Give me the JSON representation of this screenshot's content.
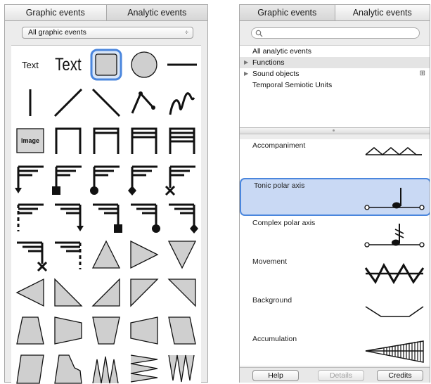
{
  "left_panel": {
    "tabs": [
      {
        "label": "Graphic events",
        "active": true
      },
      {
        "label": "Analytic events",
        "active": false
      }
    ],
    "filter": {
      "value": "All graphic events",
      "arrows": "÷"
    },
    "grid_cells": [
      {
        "name": "text-small-tool",
        "kind": "text-small",
        "text": "Text"
      },
      {
        "name": "text-large-tool",
        "kind": "text-large",
        "text": "Text"
      },
      {
        "name": "rounded-rect-tool",
        "kind": "rounded-rect",
        "selected": true
      },
      {
        "name": "circle-tool",
        "kind": "circle"
      },
      {
        "name": "horizontal-line-tool",
        "kind": "hline"
      },
      {
        "name": "vertical-line-tool",
        "kind": "vline"
      },
      {
        "name": "diagonal-up-line-tool",
        "kind": "diag-up"
      },
      {
        "name": "diagonal-down-line-tool",
        "kind": "diag-down"
      },
      {
        "name": "polyline-tool",
        "kind": "polyline"
      },
      {
        "name": "freehand-curve-tool",
        "kind": "freehand"
      },
      {
        "name": "image-tool",
        "kind": "image",
        "text": "Image"
      },
      {
        "name": "bracket-1-tool",
        "kind": "bracket1"
      },
      {
        "name": "bracket-2-tool",
        "kind": "bracket2"
      },
      {
        "name": "bracket-3-tool",
        "kind": "bracket3"
      },
      {
        "name": "bracket-4-tool",
        "kind": "bracket4"
      },
      {
        "name": "flag-arrow-tool",
        "kind": "flag-arrow"
      },
      {
        "name": "flag-square-tool",
        "kind": "flag-square"
      },
      {
        "name": "flag-circle-tool",
        "kind": "flag-circle"
      },
      {
        "name": "flag-diamond-tool",
        "kind": "flag-diamond"
      },
      {
        "name": "flag-cross-tool",
        "kind": "flag-cross"
      },
      {
        "name": "dashed-flag-tool",
        "kind": "dflag"
      },
      {
        "name": "rev-flag-arrow-tool",
        "kind": "rflag-arrow"
      },
      {
        "name": "rev-flag-square-tool",
        "kind": "rflag-square"
      },
      {
        "name": "rev-flag-circle-tool",
        "kind": "rflag-circle"
      },
      {
        "name": "rev-flag-diamond-tool",
        "kind": "rflag-diamond"
      },
      {
        "name": "rev-flag-cross-tool",
        "kind": "rflag-cross"
      },
      {
        "name": "rev-dashed-flag-tool",
        "kind": "rdflag"
      },
      {
        "name": "triangle-up-tool",
        "kind": "tri-up"
      },
      {
        "name": "triangle-right-tool",
        "kind": "tri-right"
      },
      {
        "name": "triangle-down-tool",
        "kind": "tri-down"
      },
      {
        "name": "triangle-left-tool",
        "kind": "tri-left"
      },
      {
        "name": "right-triangle-br-tool",
        "kind": "rt-br"
      },
      {
        "name": "right-triangle-bl-tool",
        "kind": "rt-bl"
      },
      {
        "name": "right-triangle-tl-tool",
        "kind": "rt-tl"
      },
      {
        "name": "right-triangle-tr-tool",
        "kind": "rt-tr"
      },
      {
        "name": "trapezoid-up-tool",
        "kind": "trap-up"
      },
      {
        "name": "trapezoid-right-tool",
        "kind": "trap-right"
      },
      {
        "name": "trapezoid-down-tool",
        "kind": "trap-down"
      },
      {
        "name": "trapezoid-left-tool",
        "kind": "trap-left"
      },
      {
        "name": "trapezoid-skew-tool",
        "kind": "trap-skew"
      },
      {
        "name": "parallelogram-tool",
        "kind": "para"
      },
      {
        "name": "notched-shape-tool",
        "kind": "notch"
      },
      {
        "name": "zigzag-up-tool",
        "kind": "zz-up"
      },
      {
        "name": "zigzag-right-tool",
        "kind": "zz-right"
      },
      {
        "name": "zigzag-down-tool",
        "kind": "zz-down"
      }
    ]
  },
  "right_panel": {
    "tabs": [
      {
        "label": "Graphic events",
        "active": false
      },
      {
        "label": "Analytic events",
        "active": true
      }
    ],
    "search": {
      "placeholder": ""
    },
    "tree": [
      {
        "label": "All analytic events",
        "expandable": false
      },
      {
        "label": "Functions",
        "expandable": true,
        "selected": true
      },
      {
        "label": "Sound objects",
        "expandable": true,
        "badge": "⊞"
      },
      {
        "label": "Temporal Semiotic Units",
        "expandable": false
      }
    ],
    "items": [
      {
        "label": "Accompaniment",
        "kind": "accompaniment"
      },
      {
        "label": "Tonic polar axis",
        "kind": "tonic",
        "selected": true
      },
      {
        "label": "Complex polar axis",
        "kind": "complex"
      },
      {
        "label": "Movement",
        "kind": "movement"
      },
      {
        "label": "Background",
        "kind": "background"
      },
      {
        "label": "Accumulation",
        "kind": "accumulation"
      }
    ],
    "buttons": {
      "help": "Help",
      "details": "Details",
      "credits": "Credits"
    }
  },
  "colors": {
    "selection_fill": "#c9d9f4",
    "selection_stroke": "#4a86dd",
    "shape_fill": "#cfcfcf"
  }
}
